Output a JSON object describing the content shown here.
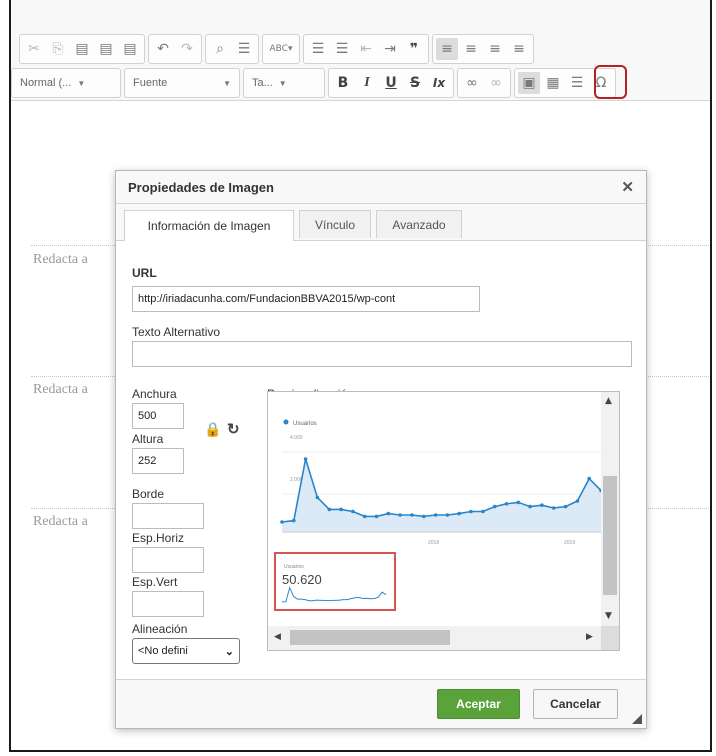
{
  "toolbar": {
    "row1": [
      {
        "name": "cut-icon",
        "glyph": "✂"
      },
      {
        "name": "copy-icon",
        "glyph": "⎘"
      },
      {
        "name": "paste-icon",
        "glyph": "📋"
      },
      {
        "name": "paste-text-icon",
        "glyph": "📋"
      },
      {
        "name": "paste-word-icon",
        "glyph": "📋"
      },
      {
        "name": "undo-icon",
        "glyph": "↶"
      },
      {
        "name": "redo-icon",
        "glyph": "↷"
      },
      {
        "name": "find-icon",
        "glyph": "🔍"
      },
      {
        "name": "replace-icon",
        "glyph": "☰"
      },
      {
        "name": "spellcheck-icon",
        "glyph": "ABC▾"
      },
      {
        "name": "numbered-list-icon",
        "glyph": "☰"
      },
      {
        "name": "bulleted-list-icon",
        "glyph": "☰"
      },
      {
        "name": "outdent-icon",
        "glyph": "⇤"
      },
      {
        "name": "indent-icon",
        "glyph": "⇥"
      },
      {
        "name": "blockquote-icon",
        "glyph": "❞"
      },
      {
        "name": "align-left-icon",
        "glyph": "≡"
      },
      {
        "name": "align-center-icon",
        "glyph": "≡"
      },
      {
        "name": "align-right-icon",
        "glyph": "≡"
      },
      {
        "name": "align-justify-icon",
        "glyph": "≡"
      }
    ],
    "format_combo": "Normal (...",
    "font_combo": "Fuente",
    "size_combo": "Ta...",
    "row2": [
      {
        "name": "bold-icon",
        "glyph": "B"
      },
      {
        "name": "italic-icon",
        "glyph": "I"
      },
      {
        "name": "underline-icon",
        "glyph": "U"
      },
      {
        "name": "strike-icon",
        "glyph": "S"
      },
      {
        "name": "remove-format-icon",
        "glyph": "Ix"
      },
      {
        "name": "link-icon",
        "glyph": "∞"
      },
      {
        "name": "unlink-icon",
        "glyph": "∞"
      },
      {
        "name": "image-icon",
        "glyph": "▣"
      },
      {
        "name": "table-icon",
        "glyph": "▦"
      },
      {
        "name": "horizontal-rule-icon",
        "glyph": "☰"
      },
      {
        "name": "special-char-icon",
        "glyph": "Ω"
      }
    ]
  },
  "editor": {
    "placeholders": [
      "Redacta a",
      "Redacta a",
      "Redacta a"
    ]
  },
  "dialog": {
    "title": "Propiedades de Imagen",
    "close": "✕",
    "tabs": [
      "Información de Imagen",
      "Vínculo",
      "Avanzado"
    ],
    "url_label": "URL",
    "url_value": "http://iriadacunha.com/FundacionBBVA2015/wp-cont",
    "alt_label": "Texto Alternativo",
    "alt_value": "",
    "width_label": "Anchura",
    "width_value": "500",
    "height_label": "Altura",
    "height_value": "252",
    "border_label": "Borde",
    "hspace_label": "Esp.Horiz",
    "vspace_label": "Esp.Vert",
    "align_label": "Alineación",
    "align_value": "<No defini",
    "preview_label": "Previsualización",
    "ok": "Aceptar",
    "cancel": "Cancelar"
  },
  "preview_chart": {
    "legend": "Usuarios",
    "ymax_label": "4.000",
    "ymid_label": "2.000",
    "x_labels": [
      "2018",
      "2019"
    ],
    "values": [
      0.0,
      0.02,
      0.9,
      0.35,
      0.18,
      0.18,
      0.15,
      0.08,
      0.08,
      0.12,
      0.1,
      0.1,
      0.08,
      0.1,
      0.1,
      0.12,
      0.15,
      0.15,
      0.22,
      0.26,
      0.28,
      0.22,
      0.24,
      0.2,
      0.22,
      0.3,
      0.62,
      0.45
    ],
    "card_title": "Usuarios",
    "card_value": "50.620",
    "color": "#2b86c9"
  }
}
